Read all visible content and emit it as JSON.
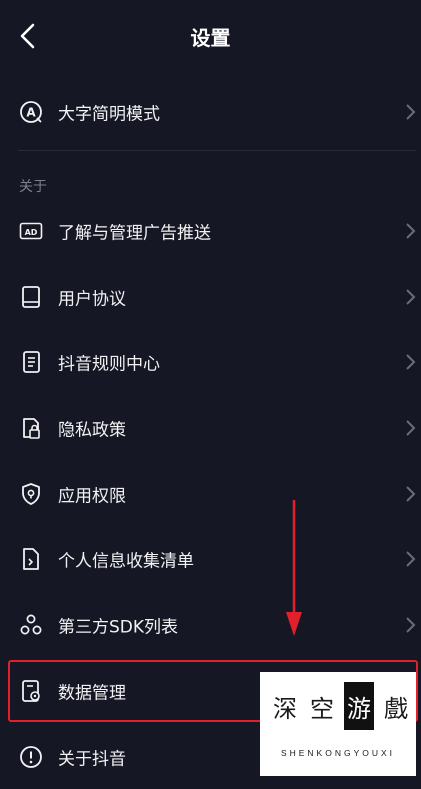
{
  "header": {
    "title": "设置"
  },
  "top_item": {
    "label": "大字简明模式",
    "icon": "font-size-icon"
  },
  "section_label": "关于",
  "items": [
    {
      "label": "了解与管理广告推送",
      "icon": "ad-icon"
    },
    {
      "label": "用户协议",
      "icon": "book-icon"
    },
    {
      "label": "抖音规则中心",
      "icon": "document-list-icon"
    },
    {
      "label": "隐私政策",
      "icon": "privacy-lock-icon"
    },
    {
      "label": "应用权限",
      "icon": "shield-icon"
    },
    {
      "label": "个人信息收集清单",
      "icon": "file-info-icon"
    },
    {
      "label": "第三方SDK列表",
      "icon": "sdk-nodes-icon"
    },
    {
      "label": "数据管理",
      "icon": "data-settings-icon"
    },
    {
      "label": "关于抖音",
      "icon": "info-icon"
    }
  ],
  "annotation": {
    "highlight_color": "#e0212b",
    "arrow_color": "#e0212b"
  },
  "watermark": {
    "glyphs": [
      "深",
      "空",
      "游",
      "戲"
    ],
    "sub": "SHENKONGYOUXI"
  },
  "colors": {
    "background": "#161724",
    "text": "#f2f2f4",
    "muted": "#7d7f8c"
  }
}
